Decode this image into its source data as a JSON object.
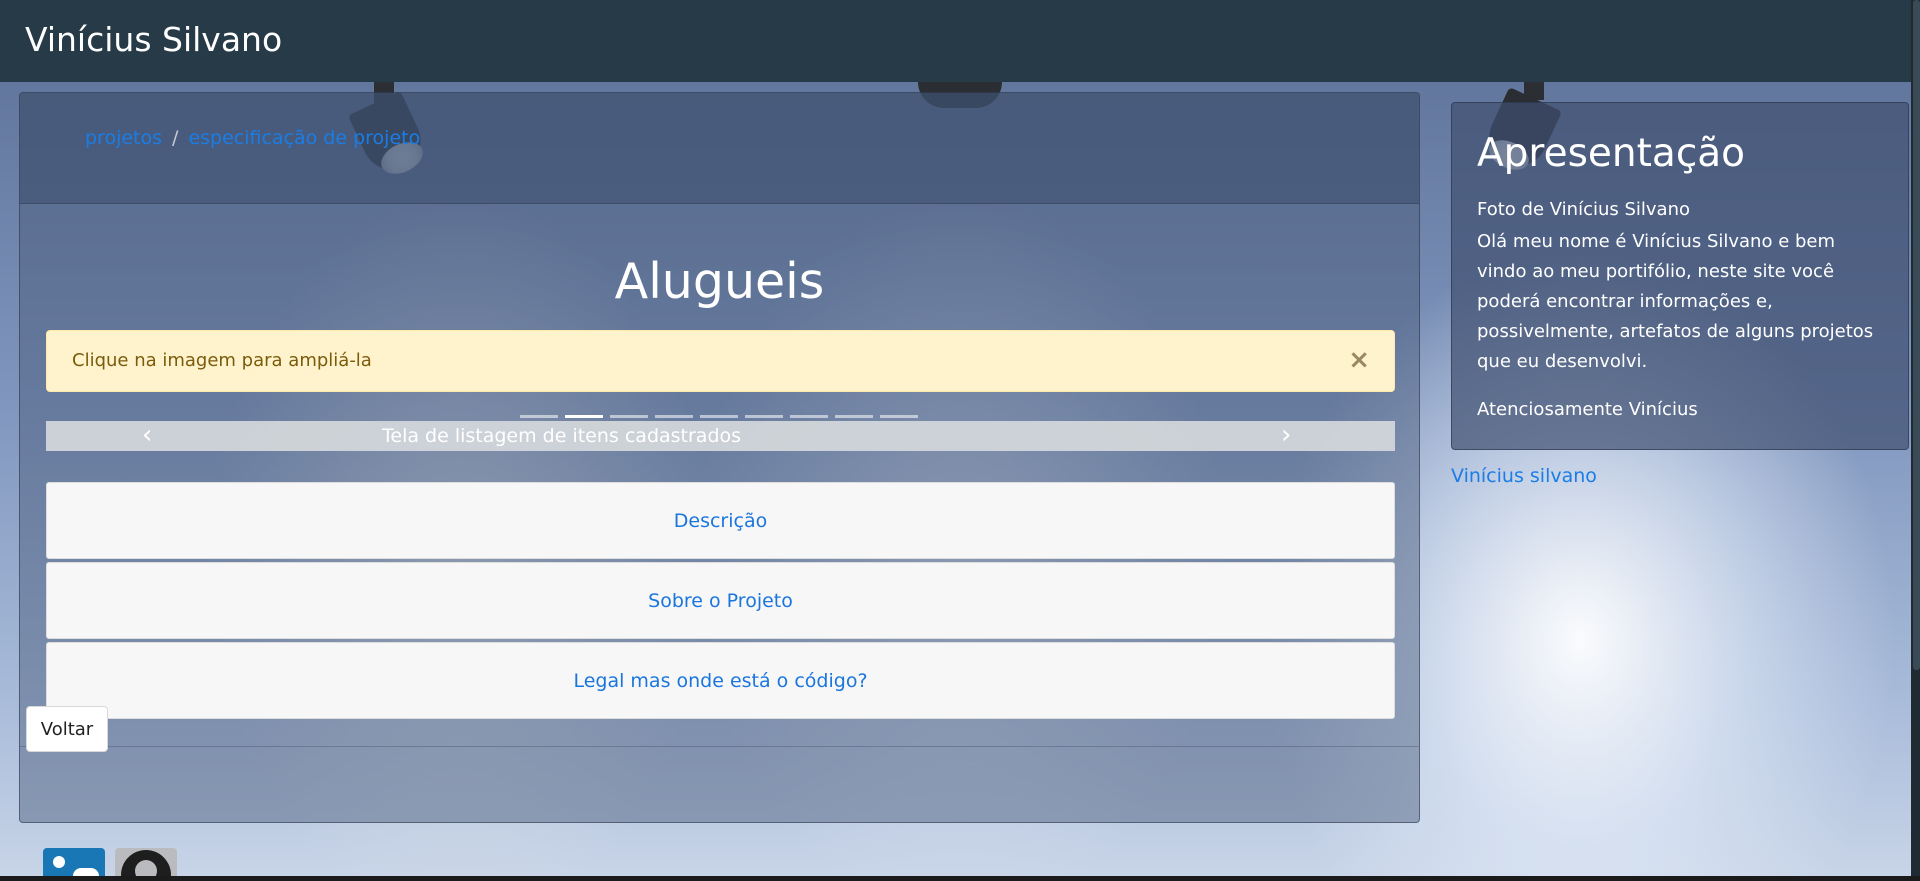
{
  "navbar": {
    "brand": "Vinícius Silvano"
  },
  "breadcrumb": {
    "items": [
      {
        "label": "projetos"
      },
      {
        "label": "especificação de projeto"
      }
    ],
    "separator": "/"
  },
  "main": {
    "title": "Alugueis",
    "alert": {
      "text": "Clique na imagem para ampliá-la",
      "close": "×"
    },
    "carousel": {
      "caption": "Tela de listagem de itens cadastrados",
      "prev": "‹",
      "next": "›",
      "indicator_count": 9,
      "active_index": 1
    },
    "accordion": [
      {
        "label": "Descrição"
      },
      {
        "label": "Sobre o Projeto"
      },
      {
        "label": "Legal mas onde está o código?"
      }
    ],
    "back_button": "Voltar"
  },
  "sidebar": {
    "title": "Apresentação",
    "photo_alt": "Foto de Vinícius Silvano",
    "text": "Olá meu nome é Vinícius Silvano e bem vindo ao meu portifólio, neste site você poderá encontrar informações e, possivelmente, artefatos de alguns projetos que eu desenvolvi.",
    "signature": "Atenciosamente Vinícius",
    "link": "Vinícius silvano"
  },
  "social": [
    {
      "icon": "linkedin-icon"
    },
    {
      "icon": "github-icon"
    }
  ],
  "colors": {
    "navbar": "#263a48",
    "link": "#1a7de6",
    "alert_bg": "#fff3cd",
    "alert_text": "#7a5c0b"
  }
}
